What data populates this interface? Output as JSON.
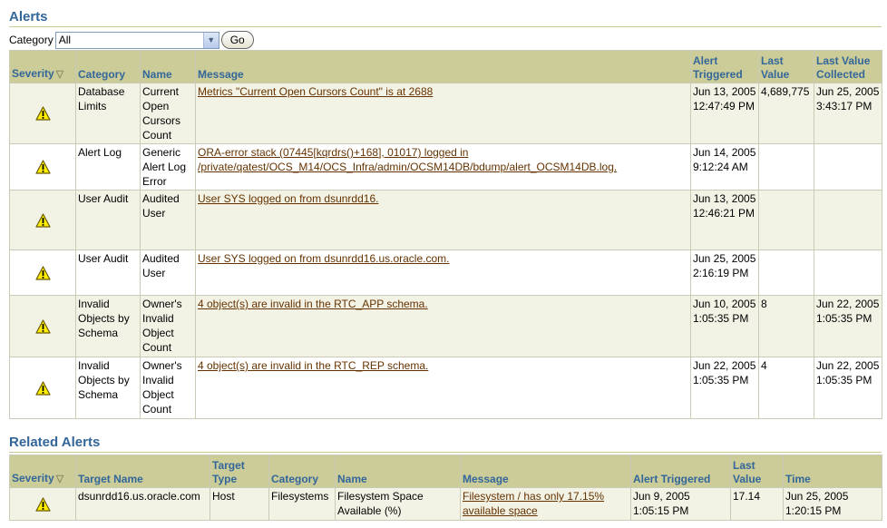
{
  "alerts": {
    "title": "Alerts",
    "category_label": "Category",
    "category_value": "All",
    "go_label": "Go",
    "sort_indicator": "▽",
    "columns": [
      "Severity",
      "Category",
      "Name",
      "Message",
      "Alert Triggered",
      "Last Value",
      "Last Value Collected"
    ],
    "rows": [
      {
        "category": "Database Limits",
        "name": "Current Open Cursors Count",
        "message": "Metrics \"Current Open Cursors Count\" is at 2688",
        "triggered": "Jun 13, 2005 12:47:49 PM",
        "last_value": "4,689,775",
        "collected": "Jun 25, 2005 3:43:17 PM"
      },
      {
        "category": "Alert Log",
        "name": "Generic Alert Log Error",
        "message": "ORA-error stack (07445[kqrdrs()+168], 01017) logged in /private/qatest/OCS_M14/OCS_Infra/admin/OCSM14DB/bdump/alert_OCSM14DB.log.",
        "triggered": "Jun 14, 2005 9:12:24 AM",
        "last_value": "",
        "collected": ""
      },
      {
        "category": "User Audit",
        "name": "Audited User",
        "message": "User SYS logged on from dsunrdd16.",
        "triggered": "Jun 13, 2005 12:46:21 PM",
        "last_value": "",
        "collected": ""
      },
      {
        "category": "User Audit",
        "name": "Audited User",
        "message": "User SYS logged on from dsunrdd16.us.oracle.com.",
        "triggered": "Jun 25, 2005 2:16:19 PM",
        "last_value": "",
        "collected": ""
      },
      {
        "category": "Invalid Objects by Schema",
        "name": "Owner's Invalid Object Count",
        "message": "4 object(s) are invalid in the RTC_APP schema.",
        "triggered": "Jun 10, 2005 1:05:35 PM",
        "last_value": "8",
        "collected": "Jun 22, 2005 1:05:35 PM"
      },
      {
        "category": "Invalid Objects by Schema",
        "name": "Owner's Invalid Object Count",
        "message": "4 object(s) are invalid in the RTC_REP schema.",
        "triggered": "Jun 22, 2005 1:05:35 PM",
        "last_value": "4",
        "collected": "Jun 22, 2005 1:05:35 PM"
      }
    ]
  },
  "related": {
    "title": "Related Alerts",
    "columns": [
      "Severity",
      "Target Name",
      "Target Type",
      "Category",
      "Name",
      "Message",
      "Alert Triggered",
      "Last Value",
      "Time"
    ],
    "rows": [
      {
        "target_name": "dsunrdd16.us.oracle.com",
        "target_type": "Host",
        "category": "Filesystems",
        "name": "Filesystem Space Available (%)",
        "message": "Filesystem / has only 17.15% available space",
        "triggered": "Jun 9, 2005 1:05:15 PM",
        "last_value": "17.14",
        "time": "Jun 25, 2005 1:20:15 PM"
      }
    ]
  },
  "colors": {
    "header_bg": "#cccc99",
    "header_text": "#336699",
    "link": "#663300",
    "warning": "#ffee00"
  },
  "icons": {
    "severity": "warning-icon"
  }
}
